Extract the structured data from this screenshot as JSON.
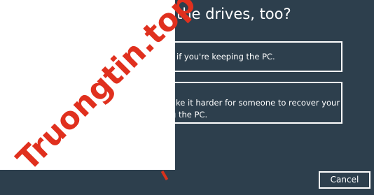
{
  "dialog": {
    "title": "the drives, too?",
    "options": {
      "keep": {
        "text": "if you're keeping the PC."
      },
      "clean": {
        "line1": "ake it harder for someone to recover your",
        "line2": "g the PC."
      }
    },
    "cancel_label": "Cancel"
  },
  "watermark": {
    "text": "Truongtin.top",
    "color": "#e0301e"
  },
  "colors": {
    "background": "#2d3f4d",
    "foreground": "#ffffff"
  }
}
